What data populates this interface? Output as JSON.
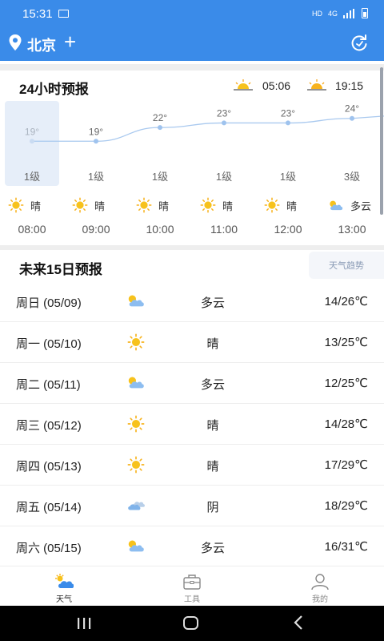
{
  "status_bar": {
    "time": "15:31",
    "network": "HD",
    "signal_label": "4G"
  },
  "header": {
    "city": "北京",
    "add_label": "+"
  },
  "hourly": {
    "title": "24小时预报",
    "sunrise": "05:06",
    "sunset": "19:15",
    "hours": [
      {
        "temp": "19°",
        "value": 19,
        "wind": "1级",
        "cond": "晴",
        "icon": "sun-icon",
        "time": "08:00",
        "selected": true
      },
      {
        "temp": "19°",
        "value": 19,
        "wind": "1级",
        "cond": "晴",
        "icon": "sun-icon",
        "time": "09:00"
      },
      {
        "temp": "22°",
        "value": 22,
        "wind": "1级",
        "cond": "晴",
        "icon": "sun-icon",
        "time": "10:00"
      },
      {
        "temp": "23°",
        "value": 23,
        "wind": "1级",
        "cond": "晴",
        "icon": "sun-icon",
        "time": "11:00"
      },
      {
        "temp": "23°",
        "value": 23,
        "wind": "1级",
        "cond": "晴",
        "icon": "sun-icon",
        "time": "12:00"
      },
      {
        "temp": "24°",
        "value": 24,
        "wind": "3级",
        "cond": "多云",
        "icon": "partly-cloudy-icon",
        "time": "13:00"
      }
    ]
  },
  "daily": {
    "title": "未来15日预报",
    "trend_label": "天气趋势",
    "days": [
      {
        "label": "周日 (05/09)",
        "cond": "多云",
        "icon": "partly-cloudy-icon",
        "temp": "14/26℃"
      },
      {
        "label": "周一 (05/10)",
        "cond": "晴",
        "icon": "sun-icon",
        "temp": "13/25℃"
      },
      {
        "label": "周二 (05/11)",
        "cond": "多云",
        "icon": "partly-cloudy-icon",
        "temp": "12/25℃"
      },
      {
        "label": "周三 (05/12)",
        "cond": "晴",
        "icon": "sun-icon",
        "temp": "14/28℃"
      },
      {
        "label": "周四 (05/13)",
        "cond": "晴",
        "icon": "sun-icon",
        "temp": "17/29℃"
      },
      {
        "label": "周五 (05/14)",
        "cond": "阴",
        "icon": "overcast-icon",
        "temp": "18/29℃"
      },
      {
        "label": "周六 (05/15)",
        "cond": "多云",
        "icon": "partly-cloudy-icon",
        "temp": "16/31℃"
      }
    ]
  },
  "bottom_nav": [
    {
      "label": "天气",
      "icon": "weather-icon",
      "active": true
    },
    {
      "label": "工具",
      "icon": "toolbox-icon"
    },
    {
      "label": "我的",
      "icon": "profile-icon"
    }
  ],
  "colors": {
    "primary": "#3a8be9",
    "sun": "#f7c21c",
    "cloud": "#7fb3ea",
    "chart_line": "#a9c9ef"
  }
}
